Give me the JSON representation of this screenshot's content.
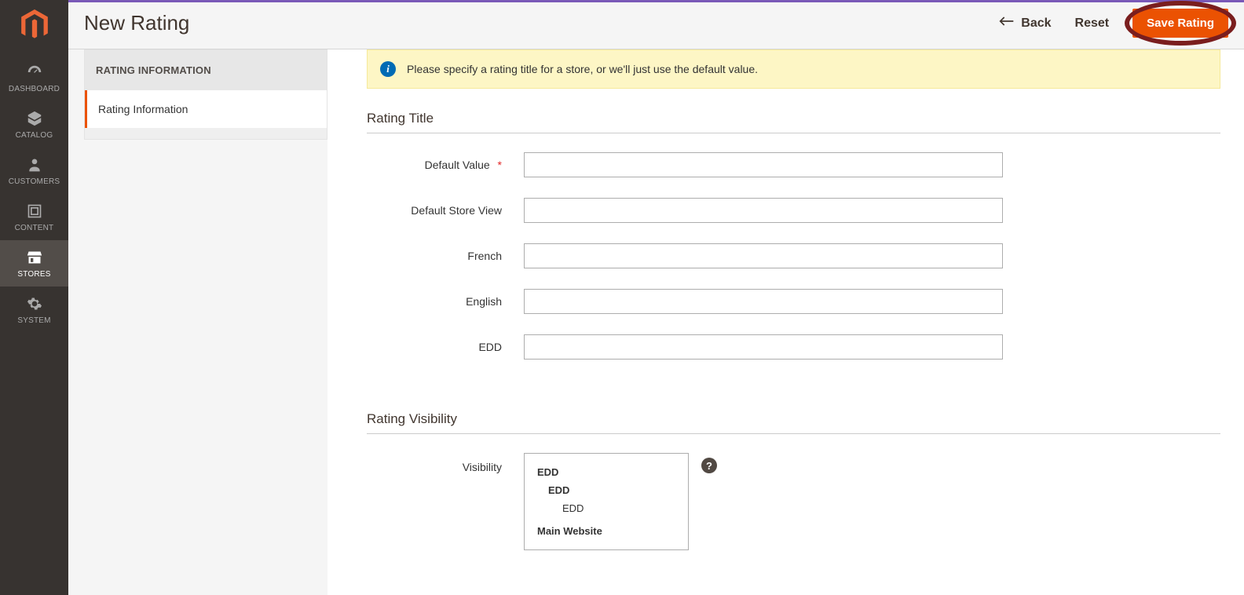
{
  "sidebar": {
    "items": [
      {
        "label": "DASHBOARD"
      },
      {
        "label": "CATALOG"
      },
      {
        "label": "CUSTOMERS"
      },
      {
        "label": "CONTENT"
      },
      {
        "label": "STORES"
      },
      {
        "label": "SYSTEM"
      }
    ]
  },
  "header": {
    "title": "New Rating",
    "back": "Back",
    "reset": "Reset",
    "save": "Save Rating"
  },
  "sidepanel": {
    "header": "RATING INFORMATION",
    "item": "Rating Information"
  },
  "notice": {
    "text": "Please specify a rating title for a store, or we'll just use the default value."
  },
  "sections": {
    "rating_title": "Rating Title",
    "rating_visibility": "Rating Visibility"
  },
  "fields": {
    "default_value": {
      "label": "Default Value",
      "required_mark": "*",
      "value": ""
    },
    "default_store_view": {
      "label": "Default Store View",
      "value": ""
    },
    "french": {
      "label": "French",
      "value": ""
    },
    "english": {
      "label": "English",
      "value": ""
    },
    "edd": {
      "label": "EDD",
      "value": ""
    },
    "visibility_label": "Visibility"
  },
  "visibility_options": {
    "g1_l0": "EDD",
    "g1_l1": "EDD",
    "g1_l2": "EDD",
    "g2_l0": "Main Website"
  },
  "icons": {
    "info": "i",
    "help": "?"
  }
}
